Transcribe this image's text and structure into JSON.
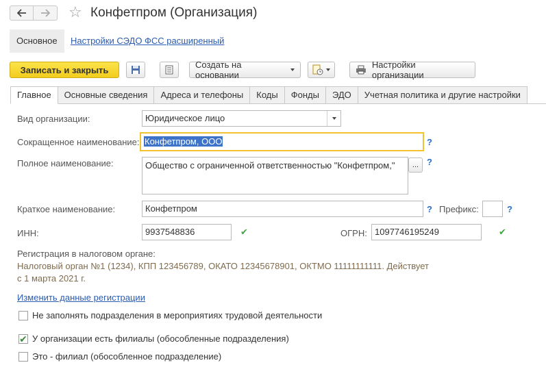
{
  "window": {
    "title": "Конфетпром (Организация)"
  },
  "sections": {
    "main": "Основное",
    "sedo_link": "Настройки СЭДО ФСС расширенный"
  },
  "toolbar": {
    "save_close": "Записать и закрыть",
    "create_based_on": "Создать на основании",
    "org_settings": "Настройки организации"
  },
  "tabs": [
    "Главное",
    "Основные сведения",
    "Адреса и телефоны",
    "Коды",
    "Фонды",
    "ЭДО",
    "Учетная политика и другие настройки"
  ],
  "form": {
    "org_type_label": "Вид организации:",
    "org_type_value": "Юридическое лицо",
    "short_name_label": "Сокращенное наименование:",
    "short_name_value": "Конфетпром, ООО",
    "full_name_label": "Полное наименование:",
    "full_name_value": "Общество с ограниченной ответственностью \"Конфетпром,\"",
    "brief_name_label": "Краткое наименование:",
    "brief_name_value": "Конфетпром",
    "prefix_label": "Префикс:",
    "prefix_value": "",
    "inn_label": "ИНН:",
    "inn_value": "9937548836",
    "ogrn_label": "ОГРН:",
    "ogrn_value": "1097746195249",
    "tax_reg_label": "Регистрация в налоговом органе:",
    "tax_reg_line1": "Налоговый орган №1 (1234), КПП 123456789, ОКАТО 12345678901, ОКТМО 11111111111. Действует",
    "tax_reg_line2": "с 1 марта 2021 г.",
    "change_reg_link": "Изменить данные регистрации",
    "question": "?",
    "ellipsis": "..."
  },
  "checkboxes": [
    {
      "label": "Не заполнять подразделения в мероприятиях трудовой деятельности",
      "checked": false
    },
    {
      "label": "У организации есть филиалы (обособленные подразделения)",
      "checked": true
    },
    {
      "label": "Это - филиал (обособленное подразделение)",
      "checked": false
    }
  ],
  "icons": {
    "back": "arrow-left-icon",
    "forward": "arrow-right-icon",
    "favorite": "star-icon",
    "save": "floppy-disk-icon",
    "document": "document-list-icon",
    "reports": "report-clock-icon",
    "print": "printer-icon",
    "dropdown": "chevron-down-icon",
    "valid": "checkmark-icon"
  },
  "colors": {
    "primary_button": "#f5d22a",
    "focus_border": "#f2c230",
    "link": "#2a5bb0",
    "help": "#2a6fc9",
    "valid_check": "#3fa63f"
  }
}
